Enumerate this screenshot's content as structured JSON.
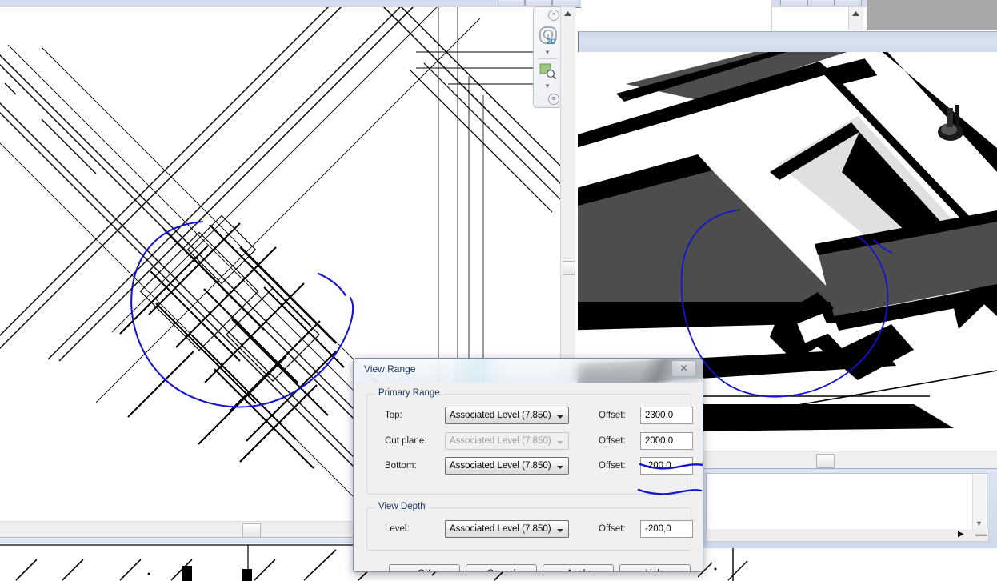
{
  "window": {
    "caption_buttons": [
      "minimize",
      "maximize",
      "close"
    ]
  },
  "nav_bar": {
    "wheel_label": "2D",
    "tools": [
      "steering-wheel-2d",
      "zoom-region"
    ],
    "close_glyph": "×",
    "grip_glyph": "≡"
  },
  "dialog": {
    "title": "View Range",
    "close_glyph": "✕",
    "groups": [
      {
        "title": "Primary Range",
        "rows": [
          {
            "label": "Top:",
            "level_value": "Associated Level (7.850)",
            "offset_label": "Offset:",
            "offset_value": "2300,0",
            "disabled": false,
            "annotated": false
          },
          {
            "label": "Cut plane:",
            "level_value": "Associated Level (7.850)",
            "offset_label": "Offset:",
            "offset_value": "2000,0",
            "disabled": true,
            "annotated": true
          },
          {
            "label": "Bottom:",
            "level_value": "Associated Level (7.850)",
            "offset_label": "Offset:",
            "offset_value": "-200,0",
            "disabled": false,
            "annotated": true
          }
        ]
      },
      {
        "title": "View Depth",
        "rows": [
          {
            "label": "Level:",
            "level_value": "Associated Level (7.850)",
            "offset_label": "Offset:",
            "offset_value": "-200,0",
            "disabled": false,
            "annotated": false
          }
        ]
      }
    ],
    "buttons": [
      {
        "label": "OK"
      },
      {
        "label": "Cancel"
      },
      {
        "label": "Apply"
      },
      {
        "label": "Help"
      }
    ]
  },
  "views": {
    "plan": {
      "name": "2d-plan-view",
      "line_color": "#000000",
      "background": "#ffffff"
    },
    "three_d": {
      "name": "3d-axonometric-view",
      "line_color": "#000000",
      "shade_dark": "#4d4d4d",
      "shade_light": "#e0e0e0",
      "background": "#ffffff"
    }
  },
  "annotations": {
    "ink_color": "#1414d2",
    "marks": [
      {
        "name": "plan-circle-markup",
        "shape": "freehand-ellipse"
      },
      {
        "name": "three-d-circle-markup",
        "shape": "freehand-ellipse"
      },
      {
        "name": "cut-plane-offset-underline",
        "shape": "freehand-underline"
      },
      {
        "name": "bottom-offset-underline",
        "shape": "freehand-underline"
      }
    ]
  },
  "scrollbars": {
    "left_vertical": {
      "thumb_position_pct": 49
    },
    "left_horizontal": {
      "thumb_position_pct": 43
    },
    "right_horizontal": {
      "thumb_position_pct": 40
    }
  }
}
